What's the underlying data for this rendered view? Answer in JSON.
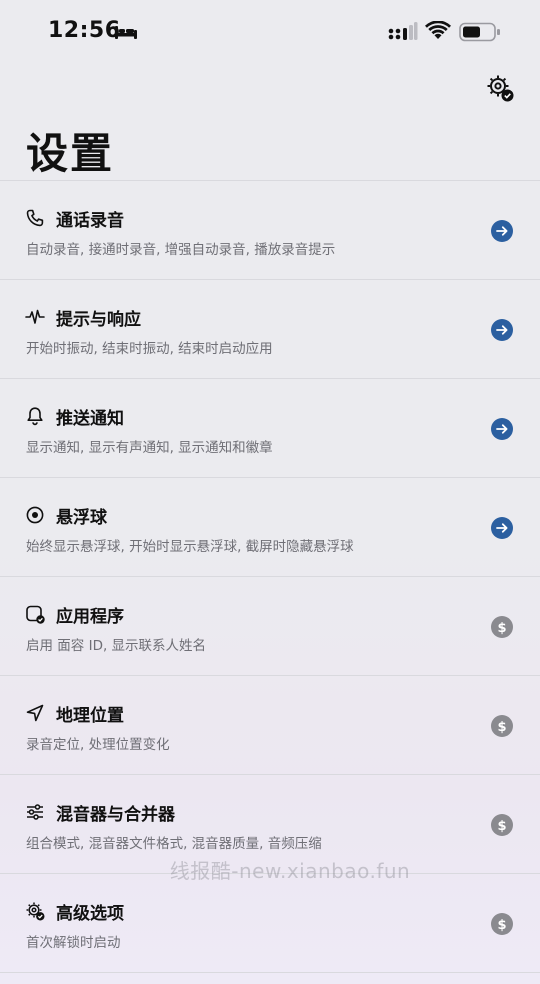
{
  "status_bar": {
    "time": "12:56",
    "icons": [
      "bed-icon",
      "cellular-signal-icon",
      "wifi-icon",
      "battery-icon"
    ]
  },
  "header": {
    "action_icon": "gear-check-icon",
    "title": "设置"
  },
  "settings": [
    {
      "title": "通话录音",
      "subtitle": "自动录音, 接通时录音, 增强自动录音, 播放录音提示",
      "icon": "phone-icon",
      "action": "arrow-right-icon"
    },
    {
      "title": "提示与响应",
      "subtitle": "开始时振动, 结束时振动, 结束时启动应用",
      "icon": "pulse-icon",
      "action": "arrow-right-icon"
    },
    {
      "title": "推送通知",
      "subtitle": "显示通知, 显示有声通知, 显示通知和徽章",
      "icon": "bell-icon",
      "action": "arrow-right-icon"
    },
    {
      "title": "悬浮球",
      "subtitle": "始终显示悬浮球, 开始时显示悬浮球, 截屏时隐藏悬浮球",
      "icon": "floating-ball-icon",
      "action": "arrow-right-icon"
    },
    {
      "title": "应用程序",
      "subtitle": "启用 面容 ID, 显示联系人姓名",
      "icon": "app-check-icon",
      "action": "dollar-icon"
    },
    {
      "title": "地理位置",
      "subtitle": "录音定位, 处理位置变化",
      "icon": "location-arrow-icon",
      "action": "dollar-icon"
    },
    {
      "title": "混音器与合并器",
      "subtitle": "组合模式, 混音器文件格式, 混音器质量, 音频压缩",
      "icon": "sliders-icon",
      "action": "dollar-icon"
    },
    {
      "title": "高级选项",
      "subtitle": "首次解锁时启动",
      "icon": "gear-check-icon",
      "action": "dollar-icon"
    }
  ],
  "watermark": "线报酷-new.xianbao.fun",
  "colors": {
    "accent_blue": "#2b5fa0",
    "paid_gray": "#8a8a8f",
    "subtitle_gray": "#6f6f76"
  }
}
